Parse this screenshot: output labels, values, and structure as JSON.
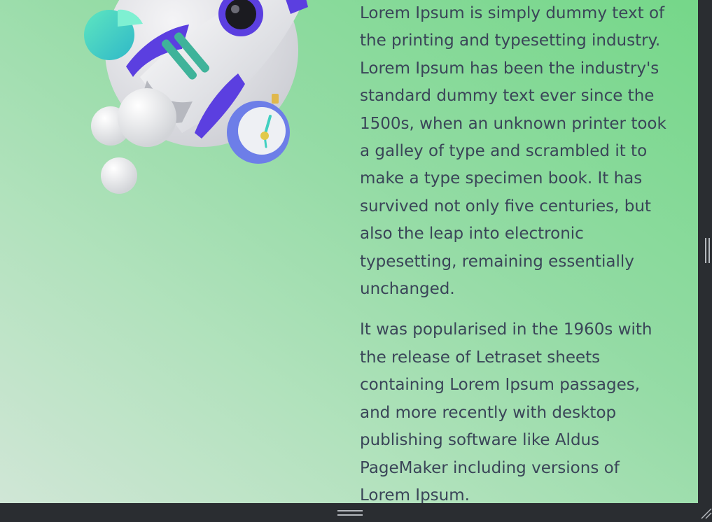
{
  "content": {
    "paragraphs": [
      "Lorem Ipsum is simply dummy text of the printing and typesetting industry. Lorem Ipsum has been the industry's standard dummy text ever since the 1500s, when an unknown printer took a galley of type and scrambled it to make a type specimen book. It has survived not only five centuries, but also the leap into electronic typesetting, remaining essentially unchanged.",
      "It was popularised in the 1960s with the release of Letraset sheets containing Lorem Ipsum passages, and more recently with desktop publishing software like Aldus PageMaker including versions of Lorem Ipsum."
    ]
  },
  "illustration": {
    "icon": "rocket-illustration",
    "elements": [
      "rocket-icon",
      "pie-chart-icon",
      "stopwatch-icon",
      "clouds"
    ]
  },
  "colors": {
    "background_light": "#d0e6d6",
    "background_accent": "#75d789",
    "text": "#3a4558",
    "rocket_purple": "#5b3fe0",
    "frame": "#2a2d31"
  }
}
